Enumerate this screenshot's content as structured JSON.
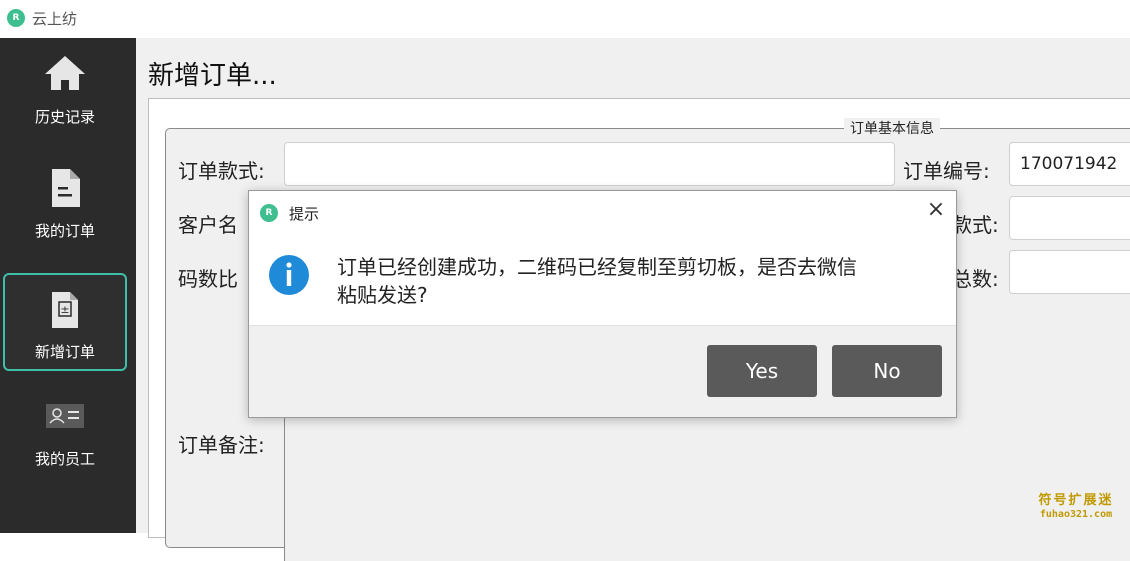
{
  "window": {
    "app_title": "云上纺",
    "logo_text": "R"
  },
  "sidebar": {
    "items": [
      {
        "label": "历史记录",
        "icon": "home-icon",
        "active": false
      },
      {
        "label": "我的订单",
        "icon": "document-icon",
        "active": false
      },
      {
        "label": "新增订单",
        "icon": "add-document-icon",
        "active": true
      },
      {
        "label": "我的员工",
        "icon": "contact-card-icon",
        "active": false
      }
    ]
  },
  "main": {
    "page_title": "新增订单...",
    "group_title": "订单基本信息",
    "fields": {
      "style_label": "订单款式:",
      "style_value": "",
      "order_no_label": "订单编号:",
      "order_no_value": "170071942",
      "customer_label": "客户名",
      "style2_label": "款式:",
      "style2_value": "",
      "ratio_label": "码数比",
      "total_label": "总数:",
      "total_value": "",
      "remark_label": "订单备注:"
    }
  },
  "dialog": {
    "title": "提示",
    "close_symbol": "×",
    "message_line1": "订单已经创建成功，二维码已经复制至剪切板，是否去微信",
    "message_line2": "粘贴发送?",
    "yes_label": "Yes",
    "no_label": "No"
  },
  "watermark": {
    "line1": "符号扩展迷",
    "line2": "fuhao321.com"
  },
  "colors": {
    "sidebar_bg": "#2b2b2b",
    "active_border": "#3fbfa8",
    "button_bg": "#5a5a5a",
    "info_blue": "#1f8ad8",
    "logo_green": "#3fbf8f"
  }
}
